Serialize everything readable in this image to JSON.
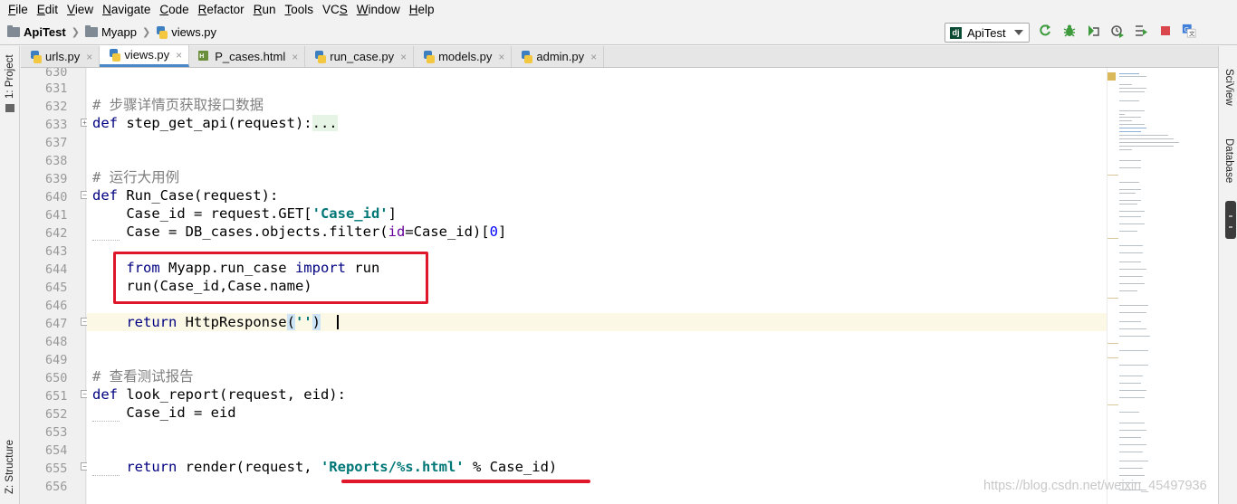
{
  "menu": [
    "File",
    "Edit",
    "View",
    "Navigate",
    "Code",
    "Refactor",
    "Run",
    "Tools",
    "VCS",
    "Window",
    "Help"
  ],
  "menu_mnemonic": [
    "F",
    "E",
    "V",
    "N",
    "C",
    "R",
    "R",
    "T",
    "S",
    "W",
    "H"
  ],
  "breadcrumb": {
    "project": "ApiTest",
    "folder": "Myapp",
    "file": "views.py"
  },
  "run_config": "ApiTest",
  "toolbar_icons": [
    "rerun-icon",
    "debug-icon",
    "coverage-icon",
    "profile-icon",
    "concurrency-icon",
    "stop-icon",
    "translate-icon"
  ],
  "left_tools": {
    "project": "1: Project",
    "structure": "Z: Structure"
  },
  "right_tools": {
    "sciview": "SciView",
    "database": "Database"
  },
  "tabs": [
    {
      "label": "urls.py",
      "icon": "python-file-icon",
      "active": false
    },
    {
      "label": "views.py",
      "icon": "python-file-icon",
      "active": true
    },
    {
      "label": "P_cases.html",
      "icon": "html-file-icon",
      "active": false
    },
    {
      "label": "run_case.py",
      "icon": "python-file-icon",
      "active": false
    },
    {
      "label": "models.py",
      "icon": "python-file-icon",
      "active": false
    },
    {
      "label": "admin.py",
      "icon": "python-file-icon",
      "active": false
    }
  ],
  "tab_close_glyph": "×",
  "line_numbers": [
    "630",
    "631",
    "632",
    "633",
    "637",
    "638",
    "639",
    "640",
    "641",
    "642",
    "643",
    "644",
    "645",
    "646",
    "647",
    "648",
    "649",
    "650",
    "651",
    "652",
    "653",
    "654",
    "655",
    "656"
  ],
  "code": {
    "l632": "# 步骤详情页获取接口数据",
    "l633_kw": "def",
    "l633_name": " step_get_api(request):",
    "l633_dots": "...",
    "l639": "# 运行大用例",
    "l640_kw": "def",
    "l640_name": " Run_Case(request):",
    "l641_a": "    Case_id = request.GET[",
    "l641_s": "'Case_id'",
    "l641_b": "]",
    "l642_a": "    Case = DB_cases.objects.filter(",
    "l642_k": "id",
    "l642_b": "=Case_id)[",
    "l642_n": "0",
    "l642_c": "]",
    "l644_kw1": "from",
    "l644_mid": " Myapp.run_case ",
    "l644_kw2": "import",
    "l644_end": " run",
    "l645": "    run(Case_id,Case.name)",
    "l647_kw": "return",
    "l647_a": " HttpResponse",
    "l647_p1": "(",
    "l647_s": "''",
    "l647_p2": ")",
    "l650": "# 查看测试报告",
    "l651_kw": "def",
    "l651_name": " look_report(request, eid):",
    "l652": "    Case_id = eid",
    "l655_kw": "return",
    "l655_a": " render(request, ",
    "l655_s": "'Reports/%s.html'",
    "l655_b": " % Case_id)"
  },
  "watermark": "https://blog.csdn.net/weixin_45497936",
  "colors": {
    "keyword": "#000080",
    "comment": "#808080",
    "string": "#007777",
    "number": "#0000ff",
    "highlight_red": "#e0172a",
    "caret_line": "#fbf9e6"
  }
}
